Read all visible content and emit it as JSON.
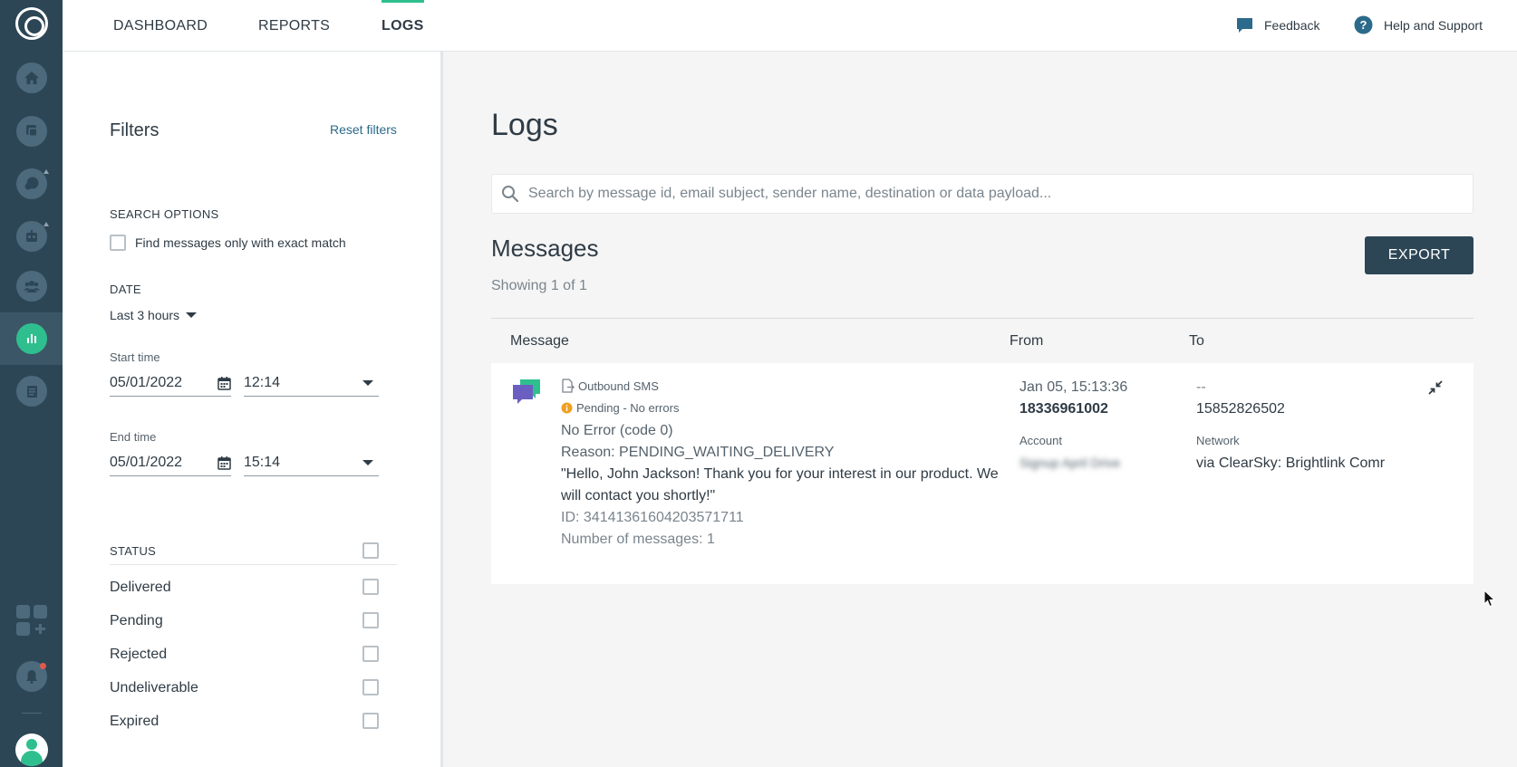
{
  "nav": {
    "tabs": [
      {
        "label": "DASHBOARD"
      },
      {
        "label": "REPORTS"
      },
      {
        "label": "LOGS"
      }
    ],
    "feedback": "Feedback",
    "help": "Help and Support"
  },
  "filters": {
    "title": "Filters",
    "reset": "Reset filters",
    "search_options": {
      "heading": "SEARCH OPTIONS",
      "exact_match": "Find messages only with exact match"
    },
    "date": {
      "heading": "DATE",
      "range": "Last 3 hours",
      "start_label": "Start time",
      "start_date": "05/01/2022",
      "start_time": "12:14",
      "end_label": "End time",
      "end_date": "05/01/2022",
      "end_time": "15:14"
    },
    "status": {
      "heading": "STATUS",
      "items": [
        {
          "label": "Delivered"
        },
        {
          "label": "Pending"
        },
        {
          "label": "Rejected"
        },
        {
          "label": "Undeliverable"
        },
        {
          "label": "Expired"
        }
      ]
    }
  },
  "main": {
    "title": "Logs",
    "search_placeholder": "Search by message id, email subject, sender name, destination or data payload...",
    "messages_title": "Messages",
    "showing": "Showing 1 of 1",
    "export": "EXPORT",
    "columns": {
      "message": "Message",
      "from": "From",
      "to": "To"
    },
    "row": {
      "direction": "Outbound SMS",
      "status": "Pending - No errors",
      "error": "No Error (code 0)",
      "reason": "Reason: PENDING_WAITING_DELIVERY",
      "text_line1": "\"Hello, John Jackson! Thank you for your interest in our product. We",
      "text_line2": "will contact you shortly!\"",
      "id": "ID: 34141361604203571711",
      "count": "Number of messages: 1",
      "from_time": "Jan 05, 15:13:36",
      "from_number": "18336961002",
      "account_label": "Account",
      "account_value": "Signup April Drive",
      "to_placeholder": "--",
      "to_number": "15852826502",
      "network_label": "Network",
      "network_value": "via ClearSky: Brightlink Comr"
    }
  },
  "colors": {
    "rail": "#2d4656",
    "accent": "#2fbf8f",
    "link": "#2b6a8a",
    "warning": "#f0a020"
  }
}
